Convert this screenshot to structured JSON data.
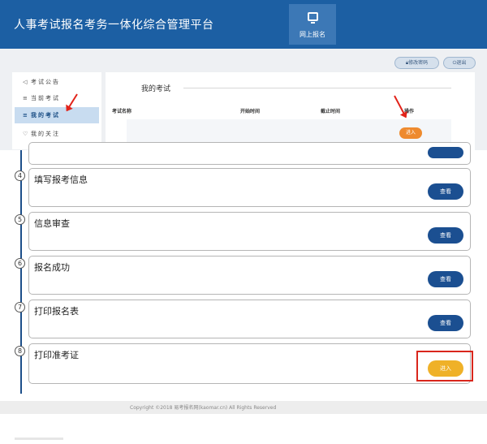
{
  "header": {
    "app_title": "人事考试报名考务一体化综合管理平台",
    "nav_tab_label": "网上报名",
    "change_password": "修改密码",
    "logout": "退出"
  },
  "sidebar": {
    "items": [
      {
        "icon": "◁",
        "label": "考试公告"
      },
      {
        "icon": "≡",
        "label": "当前考试"
      },
      {
        "icon": "≡",
        "label": "我的考试"
      },
      {
        "icon": "♡",
        "label": "我的关注"
      }
    ]
  },
  "my_exams": {
    "title": "我的考试",
    "columns": [
      "考试名称",
      "开始时间",
      "截止时间",
      "操作"
    ],
    "enter_label": "进入"
  },
  "steps": [
    {
      "num": "4",
      "title": "填写报考信息",
      "action": "查看"
    },
    {
      "num": "5",
      "title": "信息审查",
      "action": "查看"
    },
    {
      "num": "6",
      "title": "报名成功",
      "action": "查看"
    },
    {
      "num": "7",
      "title": "打印报名表",
      "action": "查看"
    },
    {
      "num": "8",
      "title": "打印准考证",
      "action": "进入"
    }
  ],
  "footer": {
    "copyright": "Copyright ©2018 易考报名网(kaomar.cn) All Rights Reserved"
  },
  "colors": {
    "header_bg": "#1c5fa3",
    "primary_button": "#1b4f91",
    "enter_orange": "#ee8a2e",
    "enter_yellow": "#efb128",
    "highlight_red": "#d9261c"
  }
}
